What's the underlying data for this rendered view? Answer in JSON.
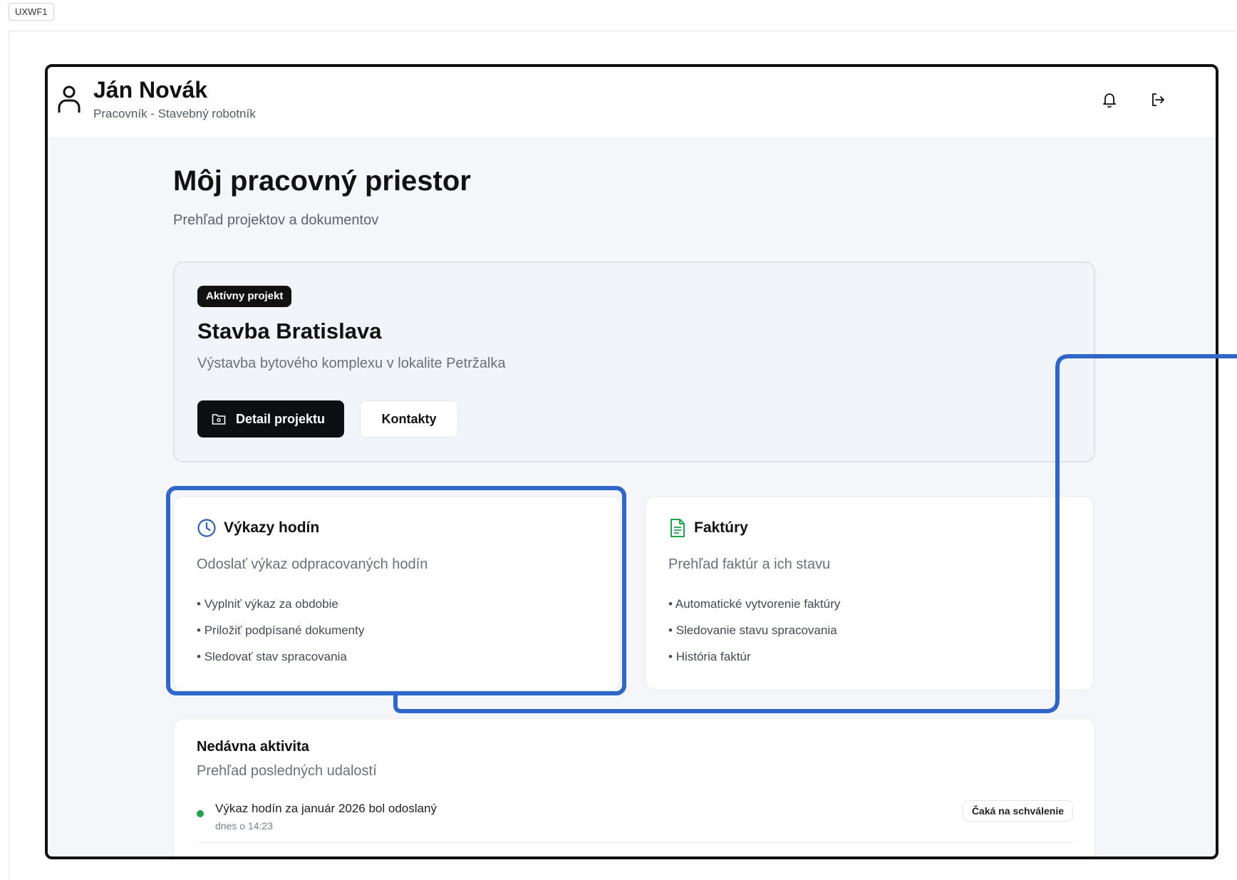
{
  "frame": {
    "tag": "UXWF1"
  },
  "header": {
    "user_name": "Ján Novák",
    "user_role": "Pracovník - Stavebný robotník",
    "icons": {
      "user": "user-icon",
      "notifications": "bell-icon",
      "logout": "logout-icon"
    }
  },
  "page": {
    "title": "Môj pracovný priestor",
    "subtitle": "Prehľad projektov a dokumentov"
  },
  "project": {
    "badge": "Aktívny projekt",
    "name": "Stavba Bratislava",
    "description": "Výstavba bytového komplexu v lokalite Petržalka",
    "detail_button": "Detail projektu",
    "contacts_button": "Kontakty"
  },
  "cards": {
    "timesheets": {
      "title": "Výkazy hodín",
      "description": "Odoslať výkaz odpracovaných hodín",
      "items": [
        "Vyplniť výkaz za obdobie",
        "Priložiť podpísané dokumenty",
        "Sledovať stav spracovania"
      ]
    },
    "invoices": {
      "title": "Faktúry",
      "description": "Prehľad faktúr a ich stavu",
      "items": [
        "Automatické vytvorenie faktúry",
        "Sledovanie stavu spracovania",
        "História faktúr"
      ]
    }
  },
  "activity": {
    "title": "Nedávna aktivita",
    "subtitle": "Prehľad posledných udalostí",
    "items": [
      {
        "text": "Výkaz hodín za január 2026 bol odoslaný",
        "time": "dnes o 14:23",
        "status": "Čaká na schválenie"
      }
    ]
  },
  "colors": {
    "accent_annotation": "#2f66c8",
    "primary_button": "#0d0f12",
    "status_dot": "#22a04b",
    "clock_icon": "#2f5fb8",
    "document_icon": "#22a04b"
  }
}
